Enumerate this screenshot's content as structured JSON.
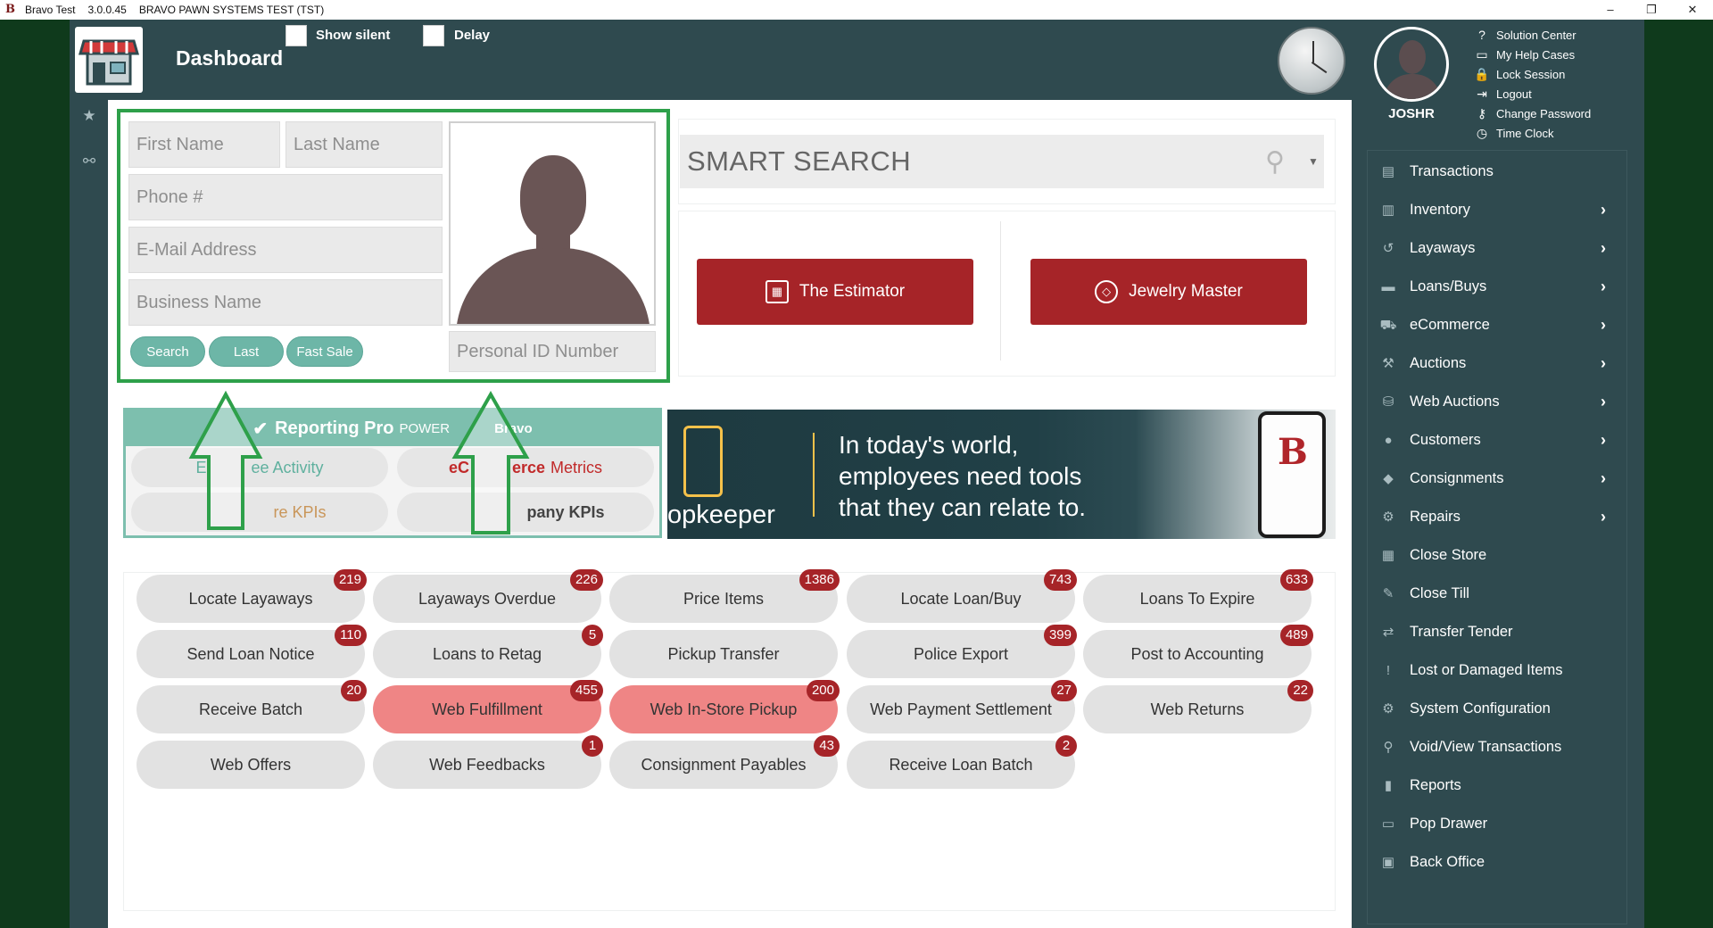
{
  "window": {
    "app_name": "Bravo Test",
    "version": "3.0.0.45",
    "system": "BRAVO PAWN SYSTEMS TEST (TST)",
    "minimize": "–",
    "restore": "❐",
    "close": "✕"
  },
  "header": {
    "title": "Dashboard",
    "show_silent_label": "Show silent",
    "delay_label": "Delay",
    "user_name": "JOSHR"
  },
  "top_links": [
    {
      "label": "Solution Center",
      "icon": "question-circle-icon",
      "glyph": "?"
    },
    {
      "label": "My Help Cases",
      "icon": "folder-icon",
      "glyph": "▭"
    },
    {
      "label": "Lock Session",
      "icon": "lock-icon",
      "glyph": "🔒"
    },
    {
      "label": "Logout",
      "icon": "logout-icon",
      "glyph": "⇥"
    },
    {
      "label": "Change Password",
      "icon": "key-icon",
      "glyph": "⚷"
    },
    {
      "label": "Time Clock",
      "icon": "clock-icon",
      "glyph": "◷"
    }
  ],
  "customer_search": {
    "first_name_placeholder": "First Name",
    "last_name_placeholder": "Last Name",
    "phone_placeholder": "Phone #",
    "email_placeholder": "E-Mail Address",
    "business_placeholder": "Business Name",
    "personal_id_placeholder": "Personal ID Number",
    "search_label": "Search",
    "last_label": "Last",
    "fast_sale_label": "Fast Sale"
  },
  "smart_search": {
    "placeholder": "SMART SEARCH",
    "search_glyph": "⚲",
    "caret_glyph": "▼"
  },
  "tools": {
    "estimator_label": "The Estimator",
    "jewelry_label": "Jewelry Master"
  },
  "reporting": {
    "title": "Reporting Pro",
    "powered": "POWER",
    "brand": "Bravo",
    "pill1_a": "E",
    "pill1_b": "ee Activity",
    "pill2_a": "eC",
    "pill2_b": "erce",
    "pill2_c": "Metrics",
    "pill3": "re KPIs",
    "pill4": "pany KPIs"
  },
  "banner": {
    "line1": "In today's world,",
    "line2": "employees need tools",
    "line3": "that they can relate to.",
    "brand": "opkeeper"
  },
  "tasks": [
    {
      "label": "Locate Layaways",
      "count": "219",
      "hot": false
    },
    {
      "label": "Layaways Overdue",
      "count": "226",
      "hot": false
    },
    {
      "label": "Price Items",
      "count": "1386",
      "hot": false
    },
    {
      "label": "Locate Loan/Buy",
      "count": "743",
      "hot": false
    },
    {
      "label": "Loans To Expire",
      "count": "633",
      "hot": false
    },
    {
      "label": "Send Loan Notice",
      "count": "110",
      "hot": false
    },
    {
      "label": "Loans to Retag",
      "count": "5",
      "hot": false
    },
    {
      "label": "Pickup Transfer",
      "count": "",
      "hot": false
    },
    {
      "label": "Police Export",
      "count": "399",
      "hot": false
    },
    {
      "label": "Post to Accounting",
      "count": "489",
      "hot": false
    },
    {
      "label": "Receive Batch",
      "count": "20",
      "hot": false
    },
    {
      "label": "Web Fulfillment",
      "count": "455",
      "hot": true
    },
    {
      "label": "Web In-Store Pickup",
      "count": "200",
      "hot": true
    },
    {
      "label": "Web Payment Settlement",
      "count": "27",
      "hot": false
    },
    {
      "label": "Web Returns",
      "count": "22",
      "hot": false
    },
    {
      "label": "Web Offers",
      "count": "",
      "hot": false
    },
    {
      "label": "Web Feedbacks",
      "count": "1",
      "hot": false
    },
    {
      "label": "Consignment Payables",
      "count": "43",
      "hot": false
    },
    {
      "label": "Receive Loan Batch",
      "count": "2",
      "hot": false
    }
  ],
  "nav": [
    {
      "label": "Transactions",
      "icon": "transactions-icon",
      "glyph": "▤",
      "chevron": ""
    },
    {
      "label": "Inventory",
      "icon": "inventory-icon",
      "glyph": "▥",
      "chevron": "›"
    },
    {
      "label": "Layaways",
      "icon": "history-icon",
      "glyph": "↺",
      "chevron": "›"
    },
    {
      "label": "Loans/Buys",
      "icon": "money-icon",
      "glyph": "▬",
      "chevron": "›"
    },
    {
      "label": "eCommerce",
      "icon": "cart-icon",
      "glyph": "⛟",
      "chevron": "›"
    },
    {
      "label": "Auctions",
      "icon": "gavel-icon",
      "glyph": "⚒",
      "chevron": "›"
    },
    {
      "label": "Web Auctions",
      "icon": "database-icon",
      "glyph": "⛁",
      "chevron": "›"
    },
    {
      "label": "Customers",
      "icon": "user-icon",
      "glyph": "●",
      "chevron": "›"
    },
    {
      "label": "Consignments",
      "icon": "tag-icon",
      "glyph": "◆",
      "chevron": "›"
    },
    {
      "label": "Repairs",
      "icon": "wrench-icon",
      "glyph": "⚙",
      "chevron": "›"
    },
    {
      "label": "Close Store",
      "icon": "store-icon",
      "glyph": "▦",
      "chevron": ""
    },
    {
      "label": "Close Till",
      "icon": "till-icon",
      "glyph": "✎",
      "chevron": ""
    },
    {
      "label": "Transfer Tender",
      "icon": "transfer-icon",
      "glyph": "⇄",
      "chevron": ""
    },
    {
      "label": "Lost or Damaged Items",
      "icon": "alert-icon",
      "glyph": "!",
      "chevron": ""
    },
    {
      "label": "System Configuration",
      "icon": "cogs-icon",
      "glyph": "⚙",
      "chevron": ""
    },
    {
      "label": "Void/View Transactions",
      "icon": "search-icon",
      "glyph": "⚲",
      "chevron": ""
    },
    {
      "label": "Reports",
      "icon": "report-icon",
      "glyph": "▮",
      "chevron": ""
    },
    {
      "label": "Pop Drawer",
      "icon": "drawer-icon",
      "glyph": "▭",
      "chevron": ""
    },
    {
      "label": "Back Office",
      "icon": "briefcase-icon",
      "glyph": "▣",
      "chevron": ""
    }
  ],
  "colors": {
    "app_bg": "#2f4a4f",
    "outer_bg": "#0f3a1c",
    "accent_red": "#a62428",
    "accent_teal": "#6db6a7",
    "highlight_green": "#2ea04a",
    "hot_task": "#ef8585"
  }
}
